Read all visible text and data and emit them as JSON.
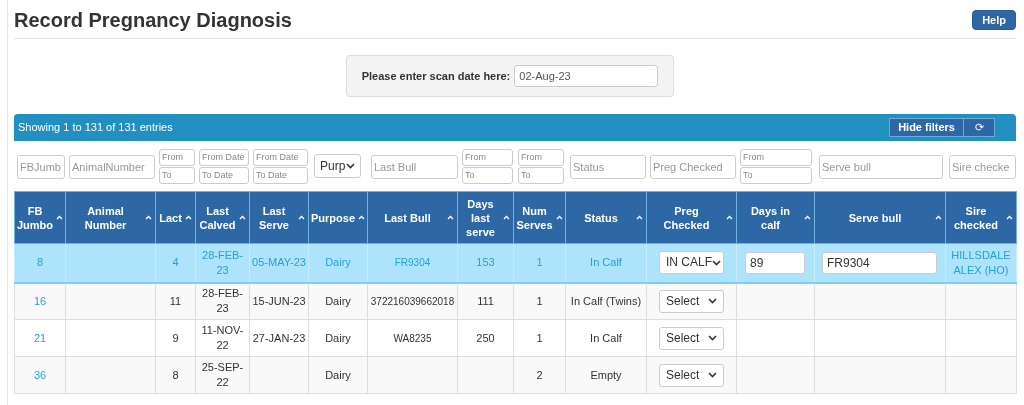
{
  "title": "Record Pregnancy Diagnosis",
  "help_button": "Help",
  "scan_date": {
    "label": "Please enter scan date here:",
    "value": "02-Aug-23"
  },
  "table_bar": {
    "info": "Showing 1 to 131 of 131 entries",
    "hide_filters": "Hide filters",
    "refresh_icon": "⟳"
  },
  "filters": [
    {
      "kind": "text",
      "placeholder": "FBJumb"
    },
    {
      "kind": "text",
      "placeholder": "AnimalNumber"
    },
    {
      "kind": "range",
      "from_placeholder": "From",
      "to_placeholder": "To"
    },
    {
      "kind": "range",
      "from_placeholder": "From Date",
      "to_placeholder": "To Date"
    },
    {
      "kind": "range",
      "from_placeholder": "From Date",
      "to_placeholder": "To Date"
    },
    {
      "kind": "select",
      "value": "Purp"
    },
    {
      "kind": "text",
      "placeholder": "Last Bull"
    },
    {
      "kind": "range",
      "from_placeholder": "From",
      "to_placeholder": "To"
    },
    {
      "kind": "range",
      "from_placeholder": "From",
      "to_placeholder": "To"
    },
    {
      "kind": "text",
      "placeholder": "Status"
    },
    {
      "kind": "text",
      "placeholder": "Preg Checked"
    },
    {
      "kind": "range",
      "from_placeholder": "From",
      "to_placeholder": "To"
    },
    {
      "kind": "text",
      "placeholder": "Serve bull"
    },
    {
      "kind": "text",
      "placeholder": "Sire checke"
    }
  ],
  "columns": [
    "FB Jumbo",
    "Animal Number",
    "Lact",
    "Last Calved",
    "Last Serve",
    "Purpose",
    "Last Bull",
    "Days last serve",
    "Num Serves",
    "Status",
    "Preg Checked",
    "Days in calf",
    "Serve bull",
    "Sire checked"
  ],
  "rows": [
    {
      "selected": true,
      "fb_jumbo": "8",
      "lact": "4",
      "last_calved": "28-FEB-23",
      "last_serve": "05-MAY-23",
      "purpose": "Dairy",
      "last_bull": "FR9304",
      "days_last_serve": "153",
      "num_serves": "1",
      "status": "In Calf",
      "preg_checked": "IN CALF",
      "days_in_calf": "89",
      "serve_bull": "FR9304",
      "sire_checked": "HILLSDALE ALEX (HO)"
    },
    {
      "selected": false,
      "fb_jumbo": "16",
      "lact": "11",
      "last_calved": "28-FEB-23",
      "last_serve": "15-JUN-23",
      "purpose": "Dairy",
      "last_bull": "372216039662018",
      "days_last_serve": "111",
      "num_serves": "1",
      "status": "In Calf (Twins)",
      "preg_checked": "Select"
    },
    {
      "selected": false,
      "fb_jumbo": "21",
      "lact": "9",
      "last_calved": "11-NOV-22",
      "last_serve": "27-JAN-23",
      "purpose": "Dairy",
      "last_bull": "WA8235",
      "days_last_serve": "250",
      "num_serves": "1",
      "status": "In Calf",
      "preg_checked": "Select"
    },
    {
      "selected": false,
      "fb_jumbo": "36",
      "lact": "8",
      "last_calved": "25-SEP-22",
      "purpose": "Dairy",
      "num_serves": "2",
      "status": "Empty",
      "preg_checked": "Select"
    }
  ]
}
